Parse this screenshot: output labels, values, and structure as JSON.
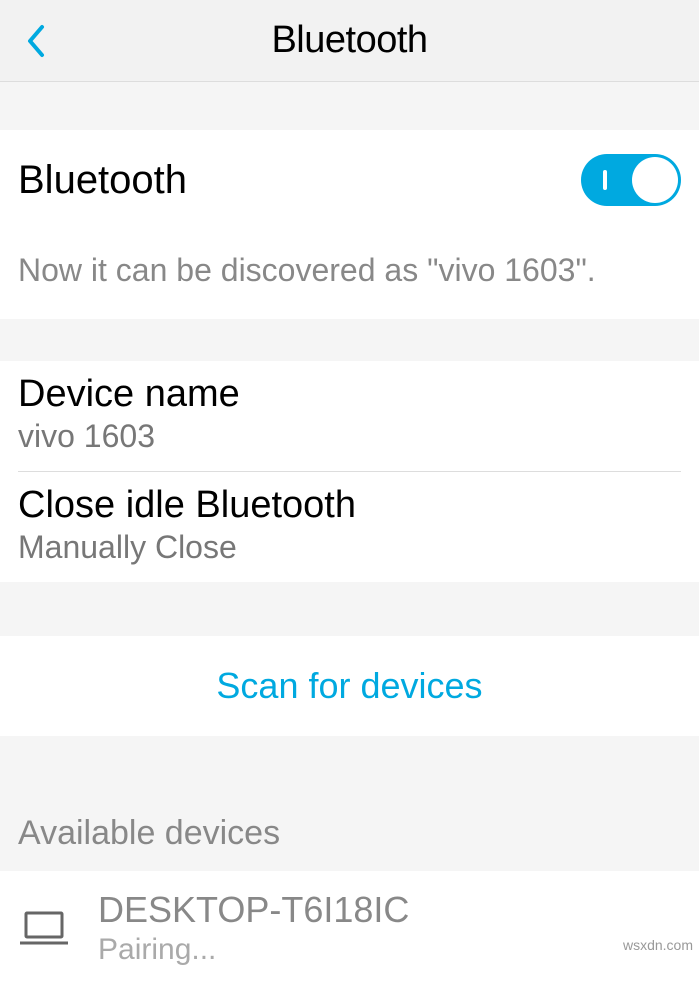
{
  "header": {
    "title": "Bluetooth"
  },
  "bluetooth": {
    "label": "Bluetooth",
    "enabled": true,
    "discover_text": "Now it can be discovered as \"vivo 1603\"."
  },
  "device_name": {
    "title": "Device name",
    "value": "vivo 1603"
  },
  "close_idle": {
    "title": "Close idle Bluetooth",
    "value": "Manually Close"
  },
  "scan": {
    "label": "Scan for devices"
  },
  "available": {
    "header": "Available devices",
    "devices": [
      {
        "name": "DESKTOP-T6I18IC",
        "status": "Pairing..."
      }
    ]
  },
  "watermark": "wsxdn.com"
}
